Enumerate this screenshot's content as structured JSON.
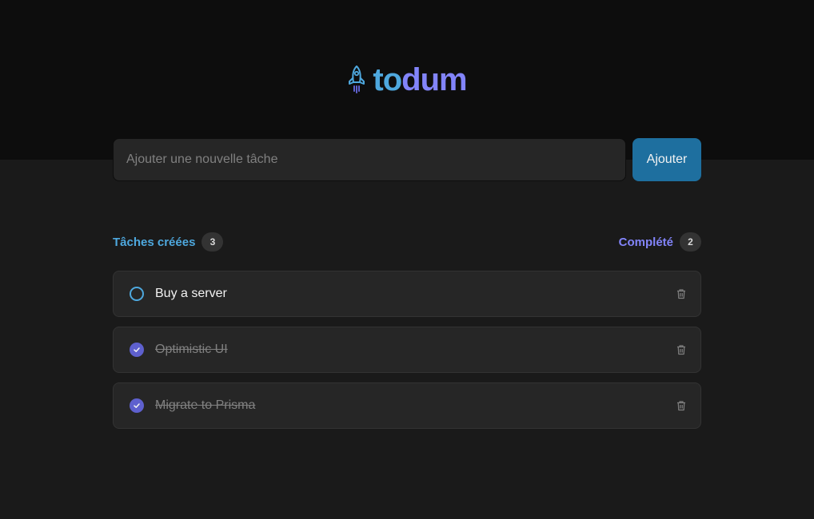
{
  "app": {
    "logo_part1": "to",
    "logo_part2": "dum",
    "logo_icon": "rocket-icon"
  },
  "new_task": {
    "placeholder": "Ajouter une nouvelle tâche",
    "value": "",
    "button_label": "Ajouter"
  },
  "counters": {
    "created_label": "Tâches créées",
    "created_count": "3",
    "completed_label": "Complété",
    "completed_count": "2"
  },
  "tasks": [
    {
      "text": "Buy a server",
      "completed": false
    },
    {
      "text": "Optimistic UI",
      "completed": true
    },
    {
      "text": "Migrate to Prisma",
      "completed": true
    }
  ],
  "colors": {
    "blue": "#4ea8de",
    "purple": "#8284fa",
    "purple_dark": "#5e60ce",
    "button_blue": "#1e6f9f",
    "header_bg": "#0d0d0d",
    "body_bg": "#1a1a1a"
  }
}
